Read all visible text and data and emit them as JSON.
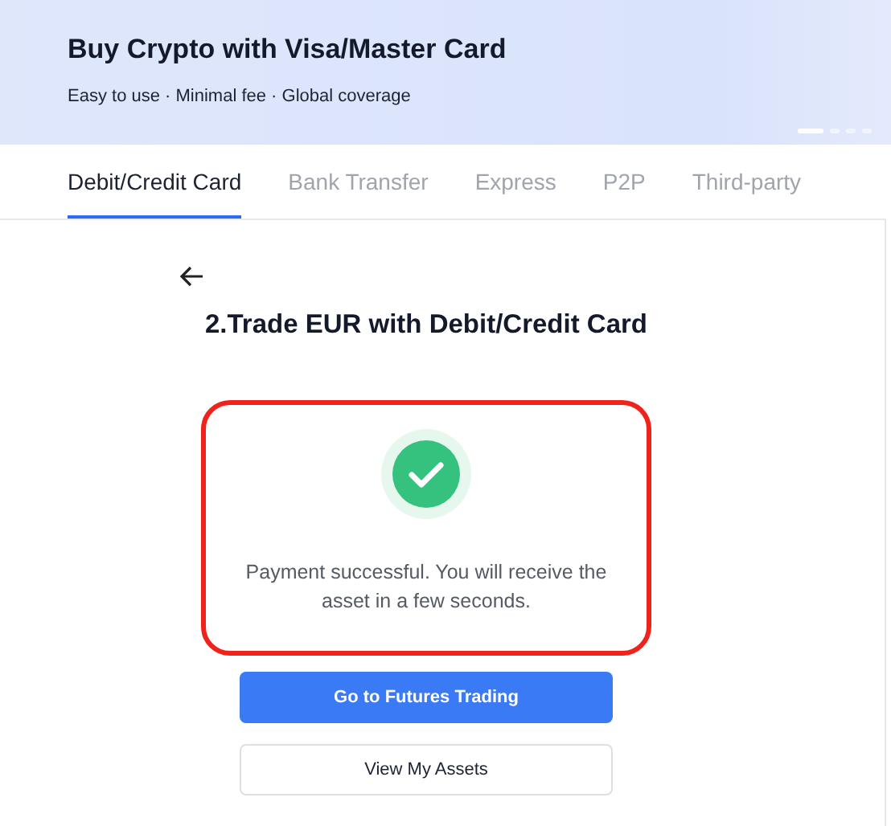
{
  "banner": {
    "title": "Buy Crypto with Visa/Master Card",
    "subtitle": "Easy to use · Minimal fee · Global coverage",
    "carousel_dots": [
      {
        "selected": true
      },
      {
        "selected": false
      },
      {
        "selected": false
      },
      {
        "selected": false
      }
    ]
  },
  "tabs": [
    {
      "label": "Debit/Credit Card",
      "selected": true
    },
    {
      "label": "Bank Transfer",
      "selected": false
    },
    {
      "label": "Express",
      "selected": false
    },
    {
      "label": "P2P",
      "selected": false
    },
    {
      "label": "Third-party",
      "selected": false
    }
  ],
  "step_title": "2.Trade EUR with Debit/Credit Card",
  "result": {
    "successful": true,
    "message": "Payment successful. You will receive the asset in a few seconds."
  },
  "buttons": [
    {
      "label": "Go to Futures Trading",
      "kind": "primary"
    },
    {
      "label": "View My Assets",
      "kind": "secondary"
    }
  ]
}
